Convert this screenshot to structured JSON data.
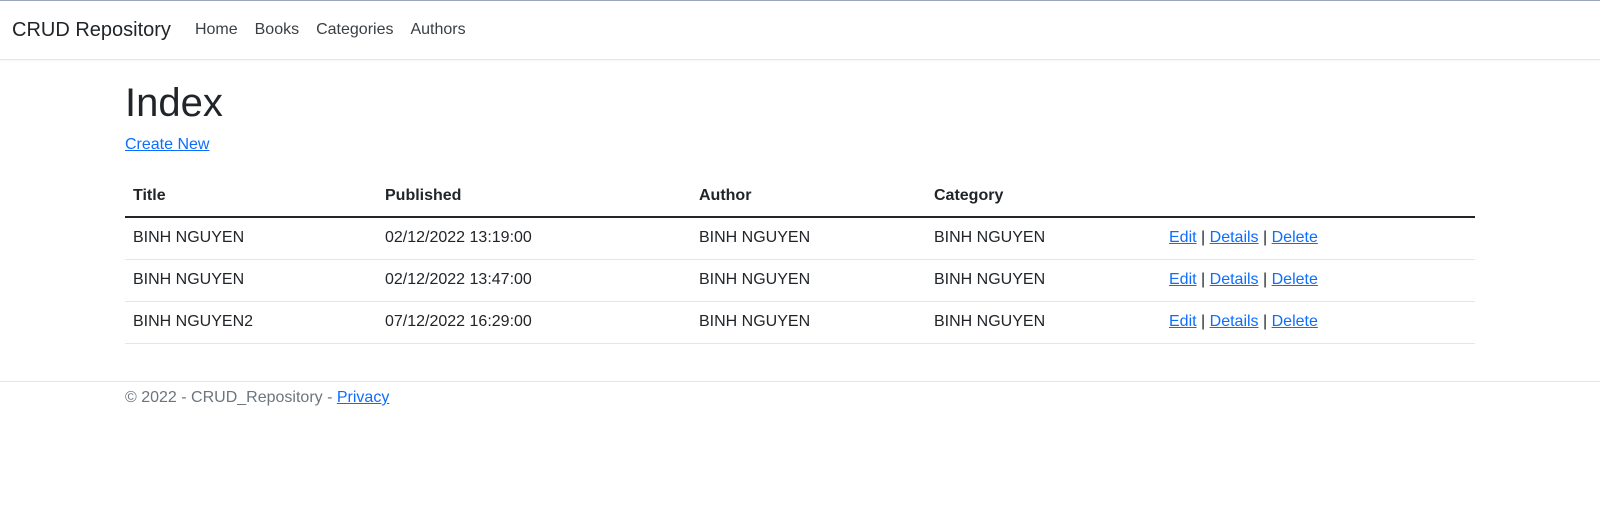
{
  "navbar": {
    "brand": "CRUD Repository",
    "links": [
      "Home",
      "Books",
      "Categories",
      "Authors"
    ]
  },
  "main": {
    "title": "Index",
    "create_link": "Create New",
    "table": {
      "headers": [
        "Title",
        "Published",
        "Author",
        "Category"
      ],
      "rows": [
        {
          "title": "BINH NGUYEN",
          "published": "02/12/2022 13:19:00",
          "author": "BINH NGUYEN",
          "category": "BINH NGUYEN"
        },
        {
          "title": "BINH NGUYEN",
          "published": "02/12/2022 13:47:00",
          "author": "BINH NGUYEN",
          "category": "BINH NGUYEN"
        },
        {
          "title": "BINH NGUYEN2",
          "published": "07/12/2022 16:29:00",
          "author": "BINH NGUYEN",
          "category": "BINH NGUYEN"
        }
      ],
      "actions": {
        "edit": "Edit",
        "details": "Details",
        "delete": "Delete",
        "separator": "|"
      }
    }
  },
  "footer": {
    "text": "© 2022 - CRUD_Repository - ",
    "privacy": "Privacy"
  },
  "colors": {
    "link": "#0d6efd",
    "text": "#212529",
    "muted": "#6c757d"
  }
}
